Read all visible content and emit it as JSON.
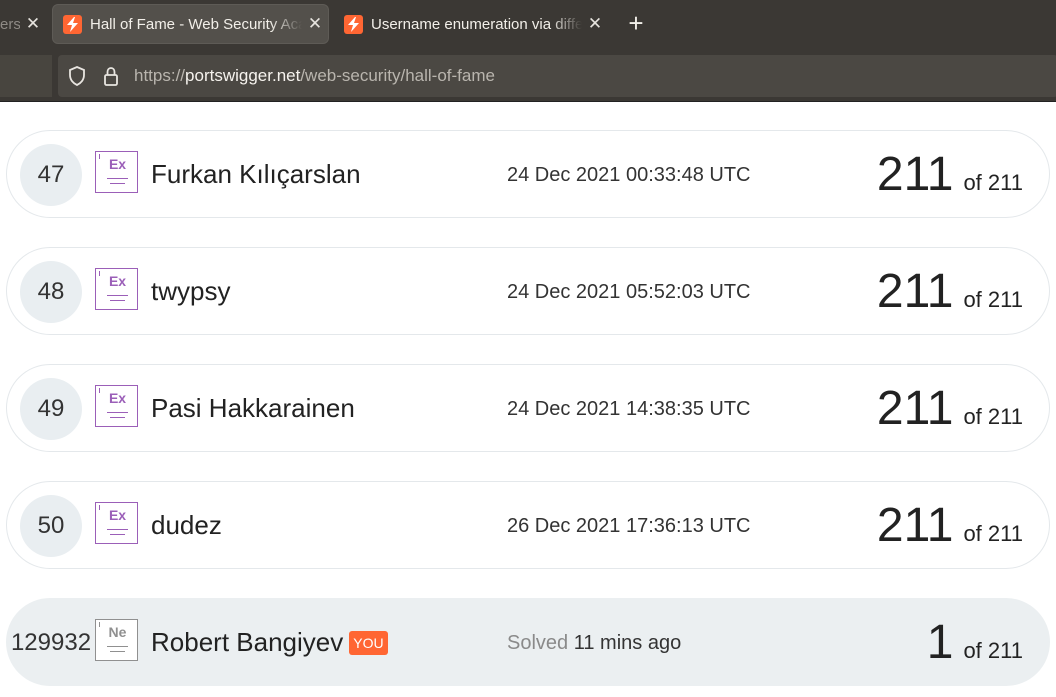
{
  "browser": {
    "tabs": [
      {
        "label": "ersi"
      },
      {
        "label": "Hall of Fame - Web Security Academy"
      },
      {
        "label": "Username enumeration via different responses"
      }
    ],
    "new_tab": "+",
    "close_glyph": "✕",
    "url": {
      "prefix": "https://",
      "domain": "portswigger.net",
      "path": "/web-security/hall-of-fame"
    }
  },
  "leaderboard": {
    "total": "211",
    "of_label": "of",
    "rows": [
      {
        "rank": "47",
        "badge": "Ex",
        "name": "Furkan Kılıçarslan",
        "time": "24 Dec 2021 00:33:48 UTC",
        "solved": "211"
      },
      {
        "rank": "48",
        "badge": "Ex",
        "name": "twypsy",
        "time": "24 Dec 2021 05:52:03 UTC",
        "solved": "211"
      },
      {
        "rank": "49",
        "badge": "Ex",
        "name": "Pasi Hakkarainen",
        "time": "24 Dec 2021 14:38:35 UTC",
        "solved": "211"
      },
      {
        "rank": "50",
        "badge": "Ex",
        "name": "dudez",
        "time": "26 Dec 2021 17:36:13 UTC",
        "solved": "211"
      }
    ],
    "current_user": {
      "rank": "129932",
      "badge": "Ne",
      "name": "Robert Bangiyev",
      "you_tag": "YOU",
      "solved_label": "Solved",
      "solved_ago": "11 mins ago",
      "solved": "1"
    }
  },
  "colors": {
    "accent": "#ff6633",
    "expert_badge": "#9b5fb8",
    "novice_badge": "#909090",
    "chrome": "#3b3834"
  }
}
